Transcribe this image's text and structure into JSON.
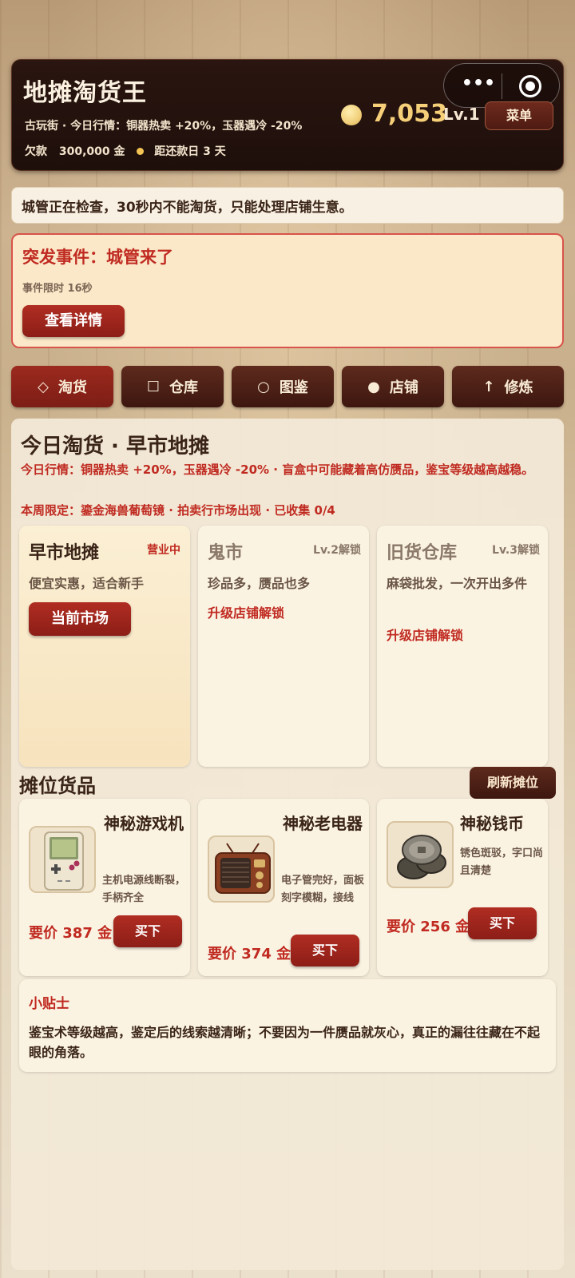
{
  "header": {
    "title": "地摊淘货王",
    "location": "古玩街",
    "market_line": "今日行情：铜器热卖 +20%，玉器遇冷 -20%",
    "debt_label": "欠款",
    "debt_value": "300,000 金",
    "due_label": "距还款日 3 天",
    "gold": "7,053",
    "level": "Lv.1",
    "menu_label": "菜单",
    "capsule_more": "•••",
    "coin_color": "#f0cf7a"
  },
  "notice": "城管正在检查，30秒内不能淘货，只能处理店铺生意。",
  "event": {
    "title": "突发事件：城管来了",
    "timer": "事件限时 16秒",
    "button": "查看详情"
  },
  "tabs": [
    {
      "icon": "◇",
      "label": "淘货",
      "active": true
    },
    {
      "icon": "☐",
      "label": "仓库",
      "active": false
    },
    {
      "icon": "○",
      "label": "图鉴",
      "active": false
    },
    {
      "icon": "●",
      "label": "店铺",
      "active": false
    },
    {
      "icon": "↑",
      "label": "修炼",
      "active": false
    }
  ],
  "main": {
    "title": "今日淘货 · 早市地摊",
    "market_info": "今日行情：铜器热卖 +20%，玉器遇冷 -20% · 盲盒中可能藏着高仿赝品，鉴宝等级越高越稳。",
    "week_limit": "本周限定：鎏金海兽葡萄镜 · 拍卖行市场出现 · 已收集 0/4",
    "markets": [
      {
        "name": "早市地摊",
        "status": "营业中",
        "desc": "便宜实惠，适合新手",
        "button": "当前市场"
      },
      {
        "name": "鬼市",
        "lock": "Lv.2解锁",
        "desc": "珍品多，赝品也多",
        "unlock": "升级店铺解锁"
      },
      {
        "name": "旧货仓库",
        "lock": "Lv.3解锁",
        "desc": "麻袋批发，一次开出多件",
        "unlock": "升级店铺解锁"
      }
    ],
    "stall_title": "摊位货品",
    "refresh_label": "刷新摊位",
    "goods": [
      {
        "name": "神秘游戏机",
        "desc": "主机电源线断裂，手柄齐全",
        "price": "要价 387 金",
        "buy": "买下",
        "icon": "gameboy-icon"
      },
      {
        "name": "神秘老电器",
        "desc": "电子管完好，面板刻字模糊，接线",
        "price": "要价 374 金",
        "buy": "买下",
        "icon": "radio-icon"
      },
      {
        "name": "神秘钱币",
        "desc": "锈色斑驳，字口尚且清楚",
        "price": "要价 256 金",
        "buy": "买下",
        "icon": "coins-icon"
      }
    ],
    "tips": {
      "title": "小贴士",
      "body": "鉴宝术等级越高，鉴定后的线索越清晰；不要因为一件赝品就灰心，真正的漏往往藏在不起眼的角落。"
    }
  }
}
